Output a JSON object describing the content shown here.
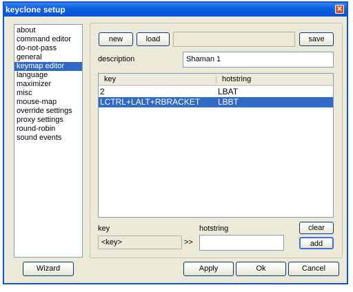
{
  "window": {
    "title": "keyclone setup",
    "close_symbol": "✕"
  },
  "sidebar": {
    "items": [
      {
        "label": "about",
        "selected": false
      },
      {
        "label": "command editor",
        "selected": false
      },
      {
        "label": "do-not-pass",
        "selected": false
      },
      {
        "label": "general",
        "selected": false
      },
      {
        "label": "keymap editor",
        "selected": true
      },
      {
        "label": "language",
        "selected": false
      },
      {
        "label": "maximizer",
        "selected": false
      },
      {
        "label": "misc",
        "selected": false
      },
      {
        "label": "mouse-map",
        "selected": false
      },
      {
        "label": "override settings",
        "selected": false
      },
      {
        "label": "proxy settings",
        "selected": false
      },
      {
        "label": "round-robin",
        "selected": false
      },
      {
        "label": "sound events",
        "selected": false
      }
    ]
  },
  "keymap": {
    "new_label": "new",
    "load_label": "load",
    "filename_value": "",
    "save_label": "save",
    "description_label": "description",
    "description_value": "Shaman 1",
    "table": {
      "columns": [
        "key",
        "hotstring"
      ],
      "rows": [
        {
          "key": "2",
          "hotstring": "LBAT",
          "selected": false
        },
        {
          "key": "LCTRL+LALT+RBRACKET",
          "hotstring": "LBBT",
          "selected": true
        }
      ]
    },
    "key_label": "key",
    "hotstring_label": "hotstring",
    "key_value": "<key>",
    "arrow": ">>",
    "hotstring_value": "",
    "clear_label": "clear",
    "add_label": "add"
  },
  "footer": {
    "wizard_label": "Wizard",
    "apply_label": "Apply",
    "ok_label": "Ok",
    "cancel_label": "Cancel"
  },
  "colors": {
    "title_bar": "#0a5fe0",
    "selection": "#316ac5",
    "dialog_bg": "#ece9d8"
  }
}
